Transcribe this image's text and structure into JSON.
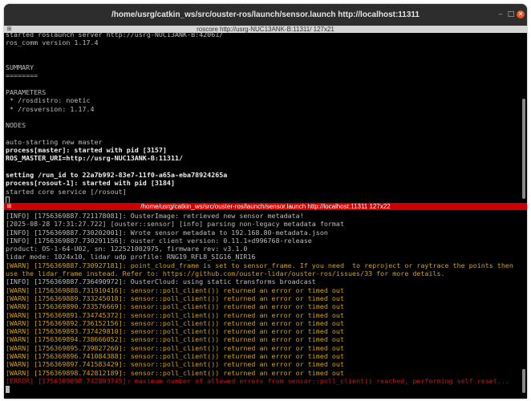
{
  "window": {
    "title": "/home/usrg/catkin_ws/src/ouster-ros/launch/sensor.launch http://localhost:11311"
  },
  "top_pane": {
    "header": "roscore http://usrg-NUC13ANK-B:11311/ 127x21",
    "lines": [
      "started roslaunch server http://usrg-NUC13ANK-B:42061/",
      "ros_comm version 1.17.4",
      "",
      "",
      "SUMMARY",
      "========",
      "",
      "PARAMETERS",
      " * /rosdistro: noetic",
      " * /rosversion: 1.17.4",
      "",
      "NODES",
      "",
      "auto-starting new master",
      "process[master]: started with pid [3157]",
      "ROS_MASTER_URI=http://usrg-NUC13ANK-B:11311/",
      "",
      "setting /run_id to 22a7b992-83e7-11f0-a65a-eba78924265a",
      "process[rosout-1]: started with pid [3184]",
      "started core service [/rosout]"
    ]
  },
  "bottom_pane": {
    "header": "/home/usrg/catkin_ws/src/ouster-ros/launch/sensor.launch http://localhost:11311 127x22",
    "lines": [
      "[INFO] [1756369887.721178081]: OusterImage: retrieved new sensor metadata!",
      "[2025-08-28 17:31:27.722] [ouster::sensor] [info] parsing non-legacy metadata format",
      "[INFO] [1756369887.730202001]: Wrote sensor metadata to 192.168.80-metadata.json",
      "[INFO] [1756369887.730291156]: ouster client version: 0.11.1+d996768-release",
      "product: OS-1-64-U02, sn: 122521002975, firmware rev: v3.1.0",
      "lidar mode: 1024x10, lidar udp profile: RNG19_RFL8_SIG16_NIR16",
      "[WARN] [1756369887.730927181]: point_cloud_frame is set to sensor_frame. If you need  to reproject or raytrace the points then",
      "use the lidar_frame instead. Refer to: https://github.com/ouster-lidar/ouster-ros/issues/33 for more details.",
      "[INFO] [1756369887.736490972]: OusterCloud: using static transforms broadcast",
      "[WARN] [1756369888.731910416]: sensor::poll_client()) returned an error or timed out",
      "[WARN] [1756369889.733245018]: sensor::poll_client()) returned an error or timed out",
      "[WARN] [1756369890.733576669]: sensor::poll_client()) returned an error or timed out",
      "[WARN] [1756369891.734745372]: sensor::poll_client()) returned an error or timed out",
      "[WARN] [1756369892.736152156]: sensor::poll_client()) returned an error or timed out",
      "[WARN] [1756369893.737429810]: sensor::poll_client()) returned an error or timed out",
      "[WARN] [1756369894.738666052]: sensor::poll_client()) returned an error or timed out",
      "[WARN] [1756369895.739827260]: sensor::poll_client()) returned an error or timed out",
      "[WARN] [1756369896.741084388]: sensor::poll_client()) returned an error or timed out",
      "[WARN] [1756369897.741583429]: sensor::poll_client()) returned an error or timed out",
      "[WARN] [1756369898.742812189]: sensor::poll_client()) returned an error or timed out",
      "[ERROR] [1756369898.742893745]: maximum number of allowed errors from sensor::poll_client() reached, performing self reset..."
    ]
  }
}
